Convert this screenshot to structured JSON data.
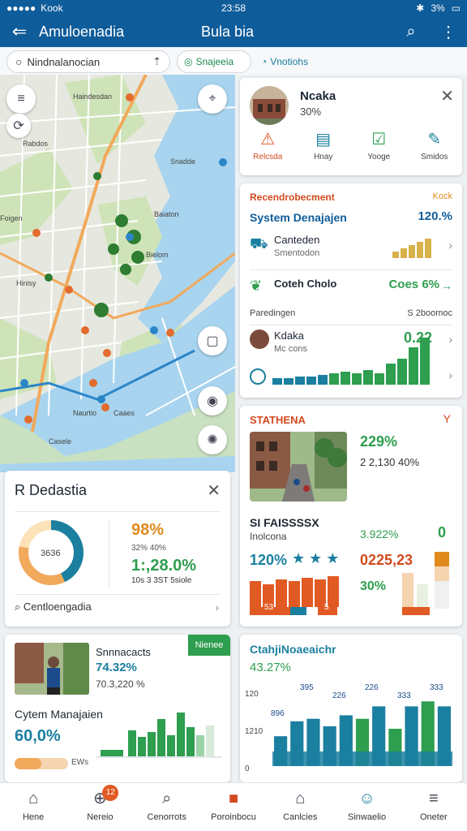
{
  "status_bar": {
    "carrier": "Kook",
    "time": "23:58",
    "battery": "3%"
  },
  "app_bar": {
    "title": "Amuloenadia",
    "subtitle": "Bula bia"
  },
  "search": {
    "value": "Nindnalanocian"
  },
  "chips": [
    "Snajeeia",
    "Vnotiohs"
  ],
  "profile_card": {
    "name": "Ncaka",
    "percent": "30%",
    "actions": [
      "Relcsda",
      "Hnay",
      "Yooge",
      "Smidos"
    ]
  },
  "recommendation_card": {
    "header": "Recendrobecment",
    "header_right": "Kock",
    "system_label": "System Denajajen",
    "system_value": "120.%",
    "rows": [
      {
        "title": "Canteden",
        "subtitle": "Smentodon"
      },
      {
        "title": "Coteh Cholo",
        "value": "Coes 6%"
      },
      {
        "title": "Paredingen",
        "value": "S 2boomoc"
      },
      {
        "title": "Kdaka",
        "subtitle": "Mc cons",
        "value": "0.22"
      }
    ]
  },
  "strategy_card": {
    "header": "STATHENA",
    "header_right": "Y",
    "stat_1": "229%",
    "stat_2": "2 2,130 40%",
    "label": "SI FAISSSSX",
    "sublabel": "Inolcona",
    "value_3": "3.922%",
    "value_4": "0",
    "value_5": "120%",
    "value_6": "0225,23",
    "value_7": "30%",
    "bottom_labels": [
      "53",
      "5"
    ]
  },
  "donut_card": {
    "title": "R Dedastia",
    "center_label": "3636",
    "value_1": "98%",
    "value_2": "32% 40%",
    "value_3": "1:,28.0%",
    "value_4": "10s 3 3ST 5siole",
    "search_label": "Centloengadia",
    "donut_fraction": 0.78
  },
  "person_card": {
    "badge": "Nienee",
    "title": "Snnnacacts",
    "percent": "74.32%",
    "amount": "70.3,220 %",
    "system_label": "Cytem Manajaien",
    "system_value": "60,0%",
    "progress_label": "EWs",
    "progress_fraction": 0.5
  },
  "chart_data": {
    "type": "bar",
    "title": "CtahjiNoaeaichr",
    "subtitle": "43.27%",
    "yticks": [
      "120",
      "1210",
      "0"
    ],
    "series": [
      {
        "name": "",
        "values": [
          60,
          90,
          95,
          80,
          102,
          95,
          120,
          75,
          120,
          130,
          120
        ]
      }
    ],
    "top_labels": [
      "395",
      "226",
      "226",
      "333",
      "333"
    ],
    "left_label": "896",
    "ylim": [
      0,
      150
    ]
  },
  "bottom_nav": [
    {
      "label": "Hene",
      "icon": "home-icon"
    },
    {
      "label": "Nereio",
      "icon": "money-icon",
      "badge": "12"
    },
    {
      "label": "Cenorrots",
      "icon": "search-icon"
    },
    {
      "label": "Poroinbocu",
      "icon": "square-icon"
    },
    {
      "label": "Canlcies",
      "icon": "building-icon"
    },
    {
      "label": "Sinwaelio",
      "icon": "user-icon"
    },
    {
      "label": "Oneter",
      "icon": "menu-icon"
    }
  ]
}
